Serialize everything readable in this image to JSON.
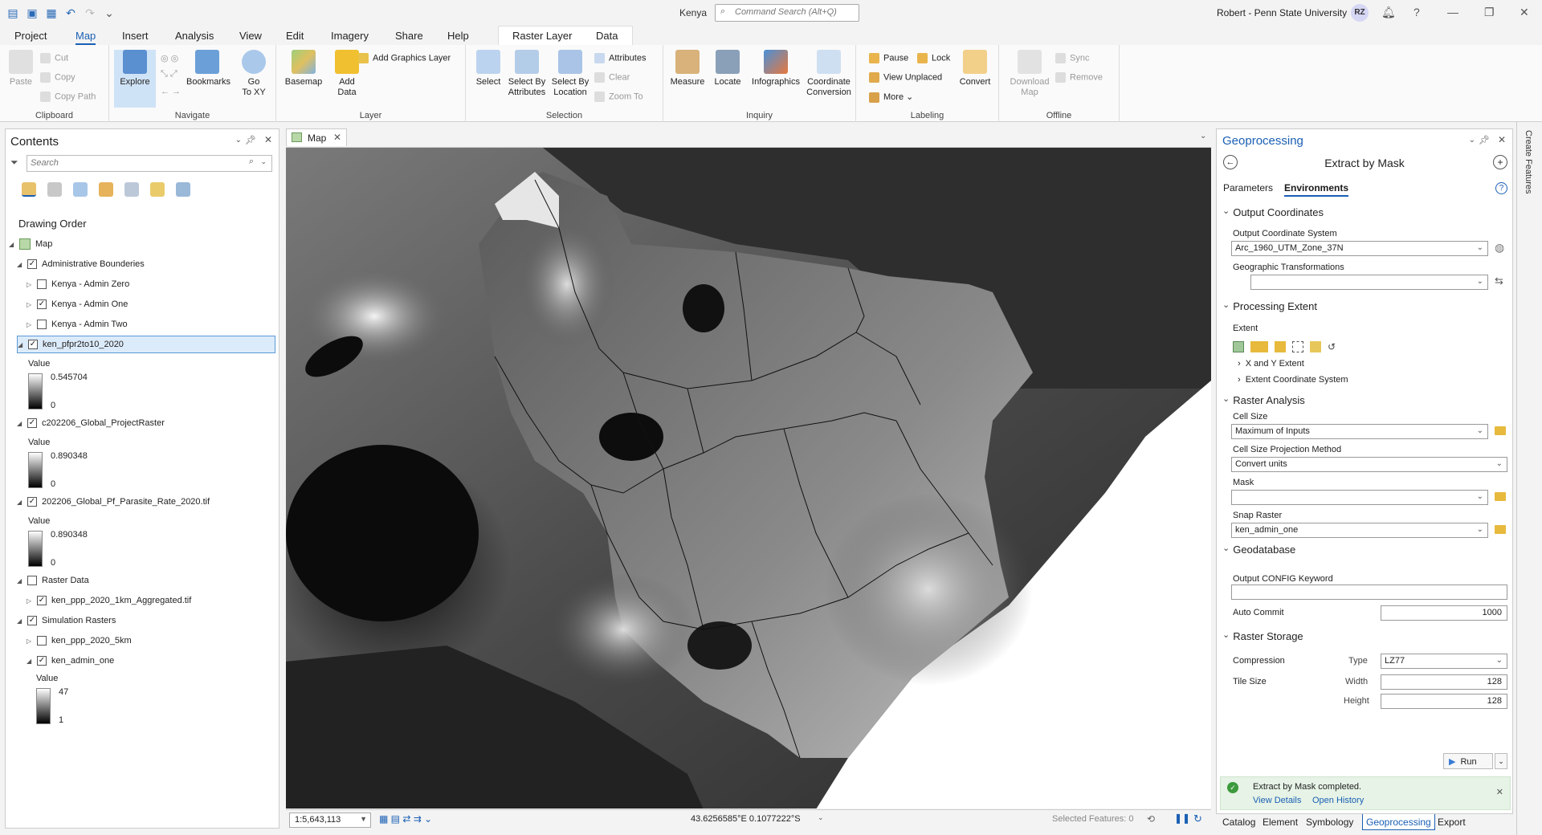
{
  "window": {
    "project_title": "Kenya",
    "command_search_placeholder": "Command Search (Alt+Q)",
    "user": "Robert - Penn State University",
    "avatar_initials": "RZ"
  },
  "ribbon_tabs": [
    "Project",
    "Map",
    "Insert",
    "Analysis",
    "View",
    "Edit",
    "Imagery",
    "Share",
    "Help",
    "Raster Layer",
    "Data"
  ],
  "active_tab": "Map",
  "ribbon": {
    "clipboard": {
      "paste": "Paste",
      "cut": "Cut",
      "copy": "Copy",
      "copy_path": "Copy Path",
      "label": "Clipboard"
    },
    "navigate": {
      "explore": "Explore",
      "bookmarks": "Bookmarks",
      "go_to": "Go",
      "go_to_2": "To XY",
      "label": "Navigate"
    },
    "layer": {
      "basemap": "Basemap",
      "add_data": "Add",
      "add_data_2": "Data",
      "add_graphics": "Add Graphics Layer",
      "label": "Layer"
    },
    "selection": {
      "select": "Select",
      "select_by_attr": "Select By",
      "select_by_attr_2": "Attributes",
      "select_by_loc": "Select By",
      "select_by_loc_2": "Location",
      "attributes": "Attributes",
      "clear": "Clear",
      "zoom_to": "Zoom To",
      "label": "Selection"
    },
    "inquiry": {
      "measure": "Measure",
      "locate": "Locate",
      "infographics": "Infographics",
      "coord_conv": "Coordinate",
      "coord_conv_2": "Conversion",
      "label": "Inquiry"
    },
    "labeling": {
      "pause": "Pause",
      "lock": "Lock",
      "view_unplaced": "View Unplaced",
      "more": "More",
      "convert": "Convert",
      "label": "Labeling"
    },
    "offline": {
      "download": "Download",
      "download_2": "Map",
      "sync": "Sync",
      "remove": "Remove",
      "label": "Offline"
    }
  },
  "contents": {
    "title": "Contents",
    "search_placeholder": "Search",
    "drawing_order": "Drawing Order",
    "map_label": "Map",
    "rows": {
      "admin_boundaries": "Administrative Bounderies",
      "admin_zero": "Kenya - Admin Zero",
      "admin_one": "Kenya - Admin One",
      "admin_two": "Kenya - Admin Two",
      "pfpr": "ken_pfpr2to10_2020",
      "global_project": "c202206_Global_ProjectRaster",
      "parasite_rate": "202206_Global_Pf_Parasite_Rate_2020.tif",
      "raster_data": "Raster Data",
      "ppp_aggregated": "ken_ppp_2020_1km_Aggregated.tif",
      "simulation_rasters": "Simulation Rasters",
      "ppp_5km": "ken_ppp_2020_5km",
      "ken_admin_one": "ken_admin_one"
    },
    "legend_value": "Value",
    "legends": {
      "pfpr": {
        "max": "0.545704",
        "min": "0"
      },
      "global_project": {
        "max": "0.890348",
        "min": "0"
      },
      "parasite_rate": {
        "max": "0.890348",
        "min": "0"
      },
      "ken_admin_one": {
        "max": "47",
        "min": "1"
      }
    }
  },
  "map": {
    "tab_label": "Map",
    "scale": "1:5,643,113",
    "coordinates": "43.6256585°E 0.1077222°S",
    "selected_features": "Selected Features: 0"
  },
  "geoprocessing": {
    "title": "Geoprocessing",
    "tool": "Extract by Mask",
    "tab_parameters": "Parameters",
    "tab_environments": "Environments",
    "output_coordinates": "Output Coordinates",
    "ocs_label": "Output Coordinate System",
    "ocs_value": "Arc_1960_UTM_Zone_37N",
    "geo_trans_label": "Geographic Transformations",
    "processing_extent": "Processing Extent",
    "extent_label": "Extent",
    "x_y_extent": "X and Y Extent",
    "extent_cs": "Extent Coordinate System",
    "raster_analysis": "Raster Analysis",
    "cell_size_label": "Cell Size",
    "cell_size_value": "Maximum of Inputs",
    "cell_proj_label": "Cell Size Projection Method",
    "cell_proj_value": "Convert units",
    "mask_label": "Mask",
    "snap_label": "Snap Raster",
    "snap_value": "ken_admin_one",
    "geodatabase": "Geodatabase",
    "config_label": "Output CONFIG Keyword",
    "auto_commit_label": "Auto Commit",
    "auto_commit_value": "1000",
    "raster_storage": "Raster Storage",
    "compression_label": "Compression",
    "type_label": "Type",
    "type_value": "LZ77",
    "tile_size_label": "Tile Size",
    "width_label": "Width",
    "width_value": "128",
    "height_label": "Height",
    "height_value": "128",
    "run": "Run",
    "status": "Extract by Mask completed.",
    "view_details": "View Details",
    "open_history": "Open History"
  },
  "bottom_tabs": [
    "Catalog",
    "Element",
    "Symbology",
    "Geoprocessing",
    "Export"
  ],
  "active_bottom_tab": "Geoprocessing",
  "side_panel": "Create Features"
}
